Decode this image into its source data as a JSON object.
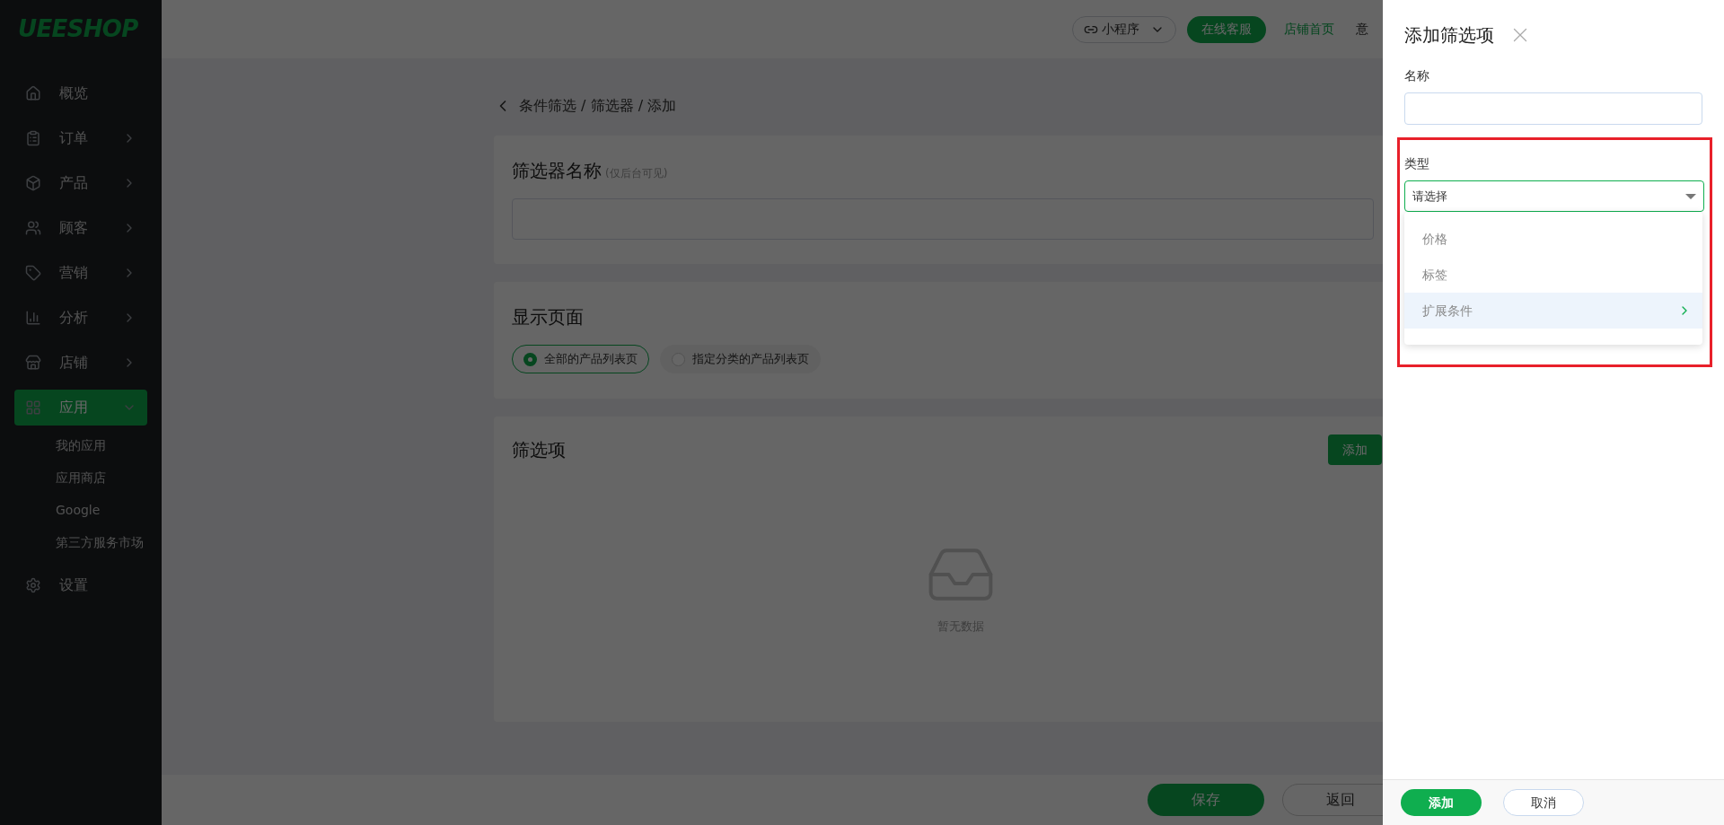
{
  "sidebar": {
    "logo": "UEESHOP",
    "items": [
      {
        "label": "概览",
        "kind": "item"
      },
      {
        "label": "订单",
        "kind": "group",
        "expanded": false,
        "selected": false
      },
      {
        "label": "产品",
        "kind": "group",
        "expanded": false,
        "selected": false
      },
      {
        "label": "顾客",
        "kind": "group",
        "expanded": false,
        "selected": false
      },
      {
        "label": "营销",
        "kind": "group",
        "expanded": false,
        "selected": false
      },
      {
        "label": "分析",
        "kind": "group",
        "expanded": false,
        "selected": false
      },
      {
        "label": "店铺",
        "kind": "group",
        "expanded": false,
        "selected": false
      },
      {
        "label": "应用",
        "kind": "group",
        "expanded": true,
        "selected": true,
        "children": [
          {
            "label": "我的应用"
          },
          {
            "label": "应用商店"
          },
          {
            "label": "Google"
          },
          {
            "label": "第三方服务市场"
          }
        ]
      },
      {
        "label": "设置",
        "kind": "item"
      }
    ]
  },
  "top_bar": {
    "mini_program": "小程序",
    "support": "在线客服",
    "store_home": "店铺首页",
    "feedback": "意"
  },
  "breadcrumb": "条件筛选 / 筛选器 / 添加",
  "name_card": {
    "title": "筛选器名称",
    "hint": "(仅后台可见)"
  },
  "display_card": {
    "title": "显示页面",
    "options": [
      {
        "label": "全部的产品列表页",
        "selected": true
      },
      {
        "label": "指定分类的产品列表页",
        "selected": false
      }
    ]
  },
  "filters_card": {
    "title": "筛选项",
    "add_button": "添加",
    "empty_text": "暂无数据"
  },
  "footer": {
    "save": "保存",
    "back": "返回"
  },
  "drawer": {
    "title": "添加筛选项",
    "name_label": "名称",
    "type_label": "类型",
    "type_placeholder": "请选择",
    "options": [
      {
        "label": "价格",
        "highlighted": false,
        "has_submenu": false
      },
      {
        "label": "标签",
        "highlighted": false,
        "has_submenu": false
      },
      {
        "label": "扩展条件",
        "highlighted": true,
        "has_submenu": true
      }
    ],
    "add_button": "添加",
    "cancel_button": "取消"
  }
}
